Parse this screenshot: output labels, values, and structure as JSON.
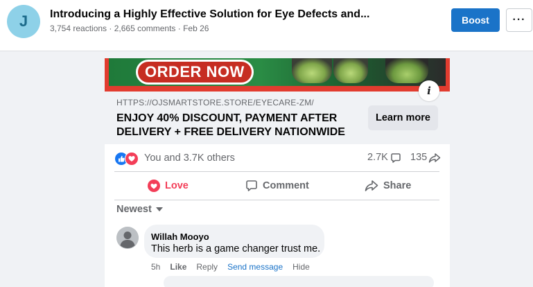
{
  "header": {
    "avatar_letter": "J",
    "title": "Introducing a Highly Effective Solution for Eye Defects and...",
    "meta": "3,754 reactions · 2,665 comments · Feb 26",
    "boost_label": "Boost",
    "more_label": "···"
  },
  "ad": {
    "banner_text": "ORDER NOW",
    "info_glyph": "i",
    "link_url": "HTTPS://OJSMARTSTORE.STORE/EYECARE-ZM/",
    "headline": "ENJOY 40% DISCOUNT, PAYMENT AFTER DELIVERY + FREE DELIVERY NATIONWIDE",
    "cta_label": "Learn more"
  },
  "engagement": {
    "reactions_text": "You and 3.7K others",
    "comments_count": "2.7K",
    "shares_count": "135"
  },
  "actions": {
    "love_label": "Love",
    "comment_label": "Comment",
    "share_label": "Share"
  },
  "comments": {
    "sort_label": "Newest",
    "items": [
      {
        "author": "Willah Mooyo",
        "text": "This herb is a game changer trust me.",
        "time": "5h",
        "like_label": "Like",
        "reply_label": "Reply",
        "message_label": "Send message",
        "hide_label": "Hide"
      }
    ]
  },
  "colors": {
    "accent": "#1a73c8",
    "love": "#f33e58",
    "banner_red": "#e23c2f",
    "muted_text": "#65676b"
  }
}
